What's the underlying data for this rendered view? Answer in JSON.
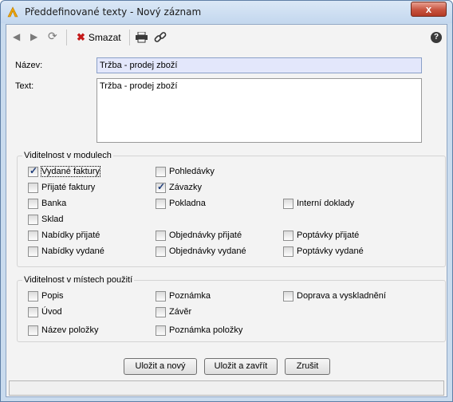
{
  "window": {
    "title": "Předdefinované texty - Nový záznam",
    "close_glyph": "x",
    "icon": "app-icon"
  },
  "toolbar": {
    "back_icon": "◀",
    "forward_icon": "▶",
    "refresh_icon": "⟳",
    "delete_label": "Smazat",
    "delete_icon": "✖",
    "print_icon": "printer-icon",
    "link_icon": "link-icon",
    "help_icon": "?"
  },
  "form": {
    "name_label": "Název:",
    "name_value": "Tržba - prodej zboží",
    "text_label": "Text:",
    "text_value": "Tržba - prodej zboží"
  },
  "modules": {
    "title": "Viditelnost v modulech",
    "items": [
      {
        "label": "Vydané faktury",
        "checked": true
      },
      {
        "label": "Pohledávky",
        "checked": false
      },
      {
        "label": "Přijaté faktury",
        "checked": false
      },
      {
        "label": "Závazky",
        "checked": true
      },
      {
        "label": "Banka",
        "checked": false
      },
      {
        "label": "Pokladna",
        "checked": false
      },
      {
        "label": "Interní doklady",
        "checked": false
      },
      {
        "label": "Sklad",
        "checked": false
      },
      {
        "label": "Nabídky přijaté",
        "checked": false
      },
      {
        "label": "Objednávky přijaté",
        "checked": false
      },
      {
        "label": "Poptávky přijaté",
        "checked": false
      },
      {
        "label": "Nabídky vydané",
        "checked": false
      },
      {
        "label": "Objednávky vydané",
        "checked": false
      },
      {
        "label": "Poptávky vydané",
        "checked": false
      }
    ]
  },
  "places": {
    "title": "Viditelnost v místech použití",
    "items": [
      {
        "label": "Popis",
        "checked": false
      },
      {
        "label": "Poznámka",
        "checked": false
      },
      {
        "label": "Doprava a vyskladnění",
        "checked": false
      },
      {
        "label": "Úvod",
        "checked": false
      },
      {
        "label": "Závěr",
        "checked": false
      },
      {
        "label": "Název položky",
        "checked": false
      },
      {
        "label": "Poznámka položky",
        "checked": false
      }
    ]
  },
  "buttons": {
    "save_new": "Uložit a nový",
    "save_close": "Uložit a zavřít",
    "cancel": "Zrušit"
  },
  "colors": {
    "name_input_bg": "#e3e7fb",
    "delete_icon": "#c41a1a",
    "title_bg": "#c3d7ee"
  }
}
